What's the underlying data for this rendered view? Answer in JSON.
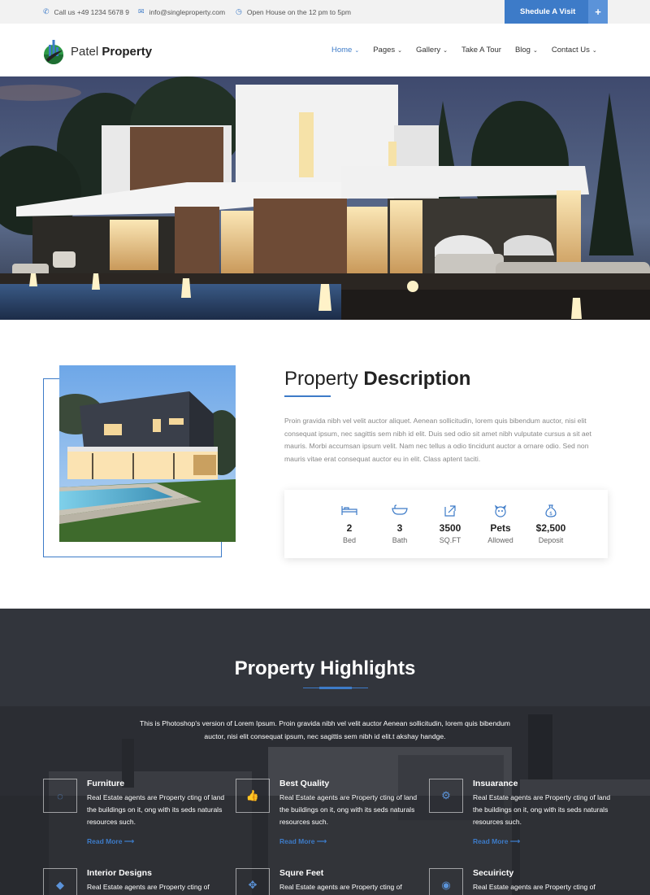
{
  "topbar": {
    "phone": "Call us +49 1234 5678 9",
    "email": "info@singleproperty.com",
    "open_house": "Open House on the 12 pm to 5pm",
    "schedule_button": "Shedule A Visit",
    "schedule_plus": "+"
  },
  "brand": {
    "name_light": "Patel",
    "name_bold": "Property"
  },
  "nav": {
    "items": [
      {
        "label": "Home",
        "dropdown": true,
        "active": true
      },
      {
        "label": "Pages",
        "dropdown": true
      },
      {
        "label": "Gallery",
        "dropdown": true
      },
      {
        "label": "Take A Tour",
        "dropdown": false
      },
      {
        "label": "Blog",
        "dropdown": true
      },
      {
        "label": "Contact Us",
        "dropdown": true
      }
    ]
  },
  "description": {
    "title_light": "Property",
    "title_bold": "Description",
    "text": "Proin gravida nibh vel velit auctor aliquet. Aenean sollicitudin, lorem quis bibendum auctor, nisi elit consequat ipsum, nec sagittis sem nibh id elit. Duis sed odio sit amet nibh vulputate cursus a sit aet mauris. Morbi accumsan ipsum velit. Nam nec tellus a odio tincidunt auctor a ornare odio. Sed non mauris vitae erat consequat auctor eu in elit. Class aptent taciti.",
    "stats": [
      {
        "icon": "bed-icon",
        "value": "2",
        "label": "Bed"
      },
      {
        "icon": "bath-icon",
        "value": "3",
        "label": "Bath"
      },
      {
        "icon": "area-icon",
        "value": "3500",
        "label": "SQ.FT"
      },
      {
        "icon": "pet-icon",
        "value": "Pets",
        "label": "Allowed"
      },
      {
        "icon": "money-bag-icon",
        "value": "$2,500",
        "label": "Deposit"
      }
    ]
  },
  "highlights": {
    "title_light": "Property",
    "title_bold": "Highlights",
    "intro": "This is Photoshop's version of Lorem Ipsum. Proin gravida nibh vel velit auctor Aenean sollicitudin, lorem quis bibendum auctor, nisi elit consequat ipsum, nec sagittis sem nibh id elit.t akshay handge.",
    "features": [
      {
        "icon": "circle-notch-icon",
        "glyph": "◌",
        "title": "Furniture",
        "text": "Real Estate agents are Property cting of land the buildings on it, ong with its seds naturals resources such.",
        "more": "Read More ⟶"
      },
      {
        "icon": "thumbs-up-icon",
        "glyph": "👍",
        "title": "Best Quality",
        "text": "Real Estate agents are Property cting of land the buildings on it, ong with its seds naturals resources such.",
        "more": "Read More ⟶"
      },
      {
        "icon": "gear-icon",
        "glyph": "⚙",
        "title": "Insuarance",
        "text": "Real Estate agents are Property cting of land the buildings on it, ong with its seds naturals resources such.",
        "more": "Read More ⟶"
      },
      {
        "icon": "cube-icon",
        "glyph": "◆",
        "title": "Interior Designs",
        "text": "Real Estate agents are Property cting of",
        "more": ""
      },
      {
        "icon": "expand-arrows-icon",
        "glyph": "✥",
        "title": "Squre Feet",
        "text": "Real Estate agents are Property cting of",
        "more": ""
      },
      {
        "icon": "eye-icon",
        "glyph": "◉",
        "title": "Secuiricty",
        "text": "Real Estate agents are Property cting of",
        "more": ""
      }
    ]
  },
  "colors": {
    "accent": "#3d7bc8",
    "dark_section": "#2b2d33",
    "topbar_bg": "#f2f2f2"
  }
}
